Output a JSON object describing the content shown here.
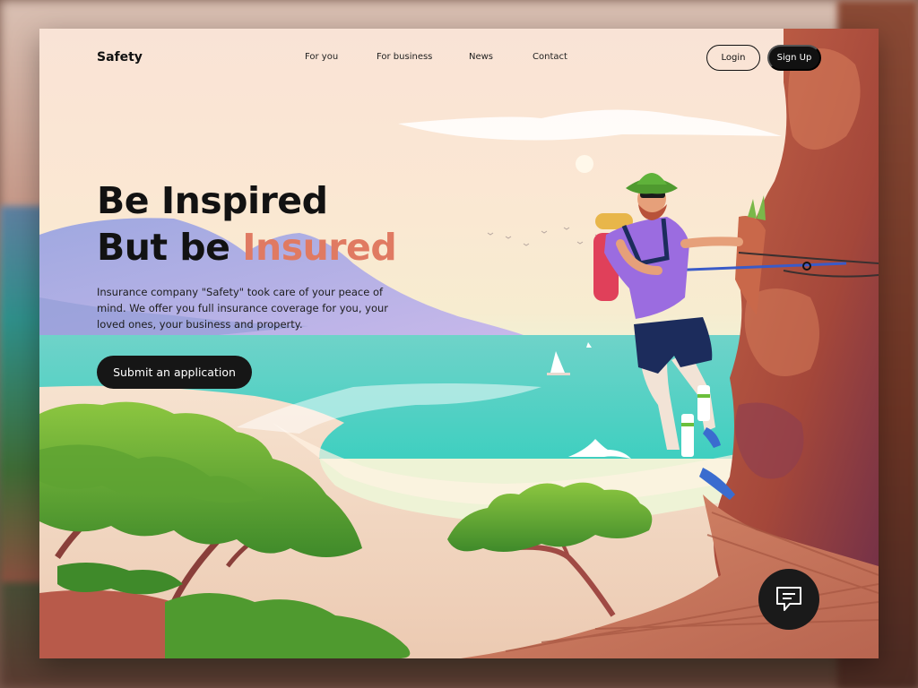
{
  "header": {
    "brand": "Safety",
    "nav": [
      "For you",
      "For business",
      "News",
      "Contact"
    ],
    "login_label": "Login",
    "signup_label": "Sign Up"
  },
  "hero": {
    "title_line1": "Be Inspired",
    "title_line2_prefix": "But be ",
    "title_line2_accent": "Insured",
    "description": "Insurance company \"Safety\" took care of your peace of mind. We offer you full insurance coverage for you, your loved ones, your business and property.",
    "cta_label": "Submit an application"
  },
  "icons": {
    "chat": "chat-bubble-icon"
  },
  "colors": {
    "accent": "#e07a62",
    "dark": "#161616",
    "sea": "#4fd6c8",
    "rock": "#b85a3e"
  }
}
